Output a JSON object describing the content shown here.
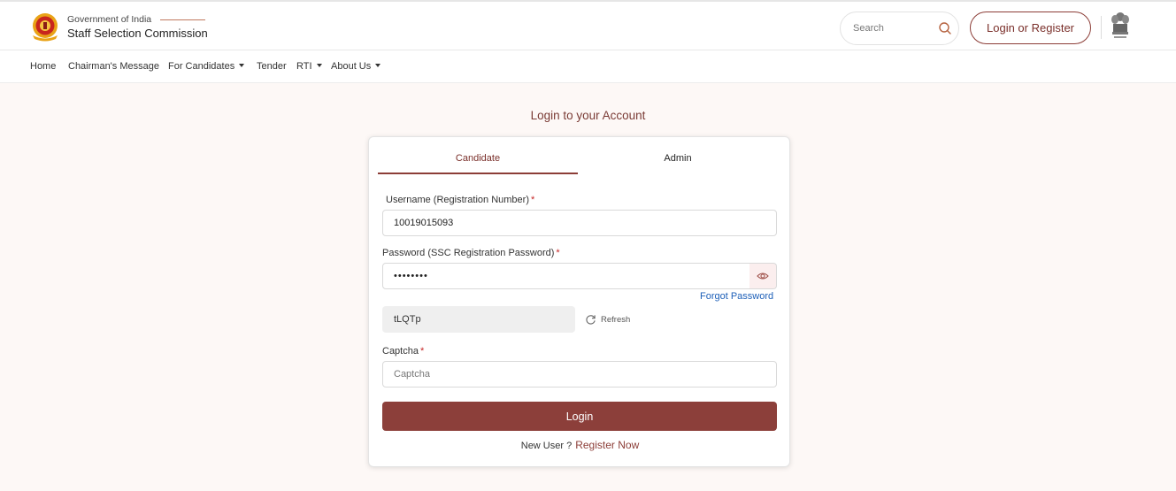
{
  "header": {
    "gov_text": "Government of India",
    "org_name": "Staff Selection Commission",
    "search_placeholder": "Search",
    "login_register_label": "Login or Register"
  },
  "nav": {
    "items": [
      {
        "label": "Home",
        "has_dropdown": false
      },
      {
        "label": "Chairman's Message",
        "has_dropdown": false
      },
      {
        "label": "For Candidates",
        "has_dropdown": true
      },
      {
        "label": "Tender",
        "has_dropdown": false
      },
      {
        "label": "RTI",
        "has_dropdown": true
      },
      {
        "label": "About Us",
        "has_dropdown": true
      }
    ]
  },
  "page": {
    "heading": "Login to your Account"
  },
  "form": {
    "tabs": [
      {
        "label": "Candidate",
        "active": true
      },
      {
        "label": "Admin",
        "active": false
      }
    ],
    "username_label": "Username (Registration Number)",
    "username_value": "10019015093",
    "password_label": "Password (SSC Registration Password)",
    "password_value": "••••••••",
    "required_mark": "*",
    "forgot_password": "Forgot Password",
    "captcha_text": "tLQTp",
    "refresh_label": "Refresh",
    "captcha_label": "Captcha",
    "captcha_placeholder": "Captcha",
    "login_button": "Login",
    "new_user_text": "New User ?",
    "register_link": "Register Now"
  },
  "colors": {
    "brand": "#8c3d37",
    "link": "#1d5fb8",
    "background": "#fdf8f6"
  },
  "icons": [
    "ssc-emblem-icon",
    "search-icon",
    "national-emblem-icon",
    "eye-icon",
    "refresh-icon",
    "caret-down-icon"
  ]
}
